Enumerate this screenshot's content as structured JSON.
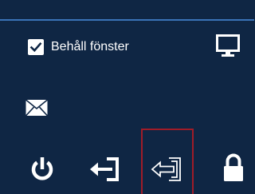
{
  "panel": {
    "background_color": "#0f2644",
    "accent_color": "#3a73b8",
    "highlight_color": "#a01c28"
  },
  "keep_window": {
    "label": "Behåll fönster",
    "checked": true
  },
  "icons": {
    "display": "monitor-icon",
    "message": "envelope-icon",
    "power": "power-icon",
    "logout": "logout-arrow-icon",
    "logout_selected": "logout-outline-arrow-icon",
    "lock": "lock-icon"
  }
}
